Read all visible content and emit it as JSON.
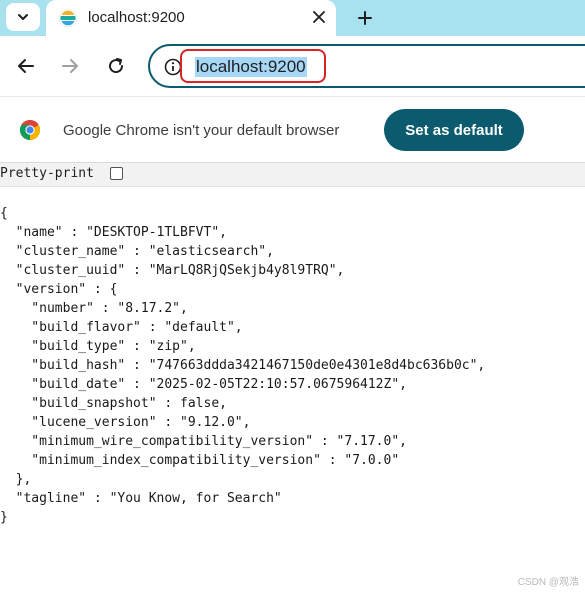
{
  "tab": {
    "title": "localhost:9200"
  },
  "address_bar": {
    "url": "localhost:9200"
  },
  "infobar": {
    "message": "Google Chrome isn't your default browser",
    "button_label": "Set as default"
  },
  "pretty_print": {
    "label": "Pretty-print",
    "checked": false
  },
  "json_lines": [
    "{",
    "  \"name\" : \"DESKTOP-1TLBFVT\",",
    "  \"cluster_name\" : \"elasticsearch\",",
    "  \"cluster_uuid\" : \"MarLQ8RjQSekjb4y8l9TRQ\",",
    "  \"version\" : {",
    "    \"number\" : \"8.17.2\",",
    "    \"build_flavor\" : \"default\",",
    "    \"build_type\" : \"zip\",",
    "    \"build_hash\" : \"747663ddda3421467150de0e4301e8d4bc636b0c\",",
    "    \"build_date\" : \"2025-02-05T22:10:57.067596412Z\",",
    "    \"build_snapshot\" : false,",
    "    \"lucene_version\" : \"9.12.0\",",
    "    \"minimum_wire_compatibility_version\" : \"7.17.0\",",
    "    \"minimum_index_compatibility_version\" : \"7.0.0\"",
    "  },",
    "  \"tagline\" : \"You Know, for Search\"",
    "}"
  ],
  "watermark": "CSDN @观浩",
  "colors": {
    "accent": "#0b5a6e",
    "tabstrip": "#a8e2ef",
    "highlight_box": "#d82424",
    "selection": "#a6d7f7"
  },
  "icons": [
    "tab-search-icon",
    "elastic-favicon",
    "close-icon",
    "plus-icon",
    "back-arrow-icon",
    "forward-arrow-icon",
    "reload-icon",
    "info-icon",
    "chrome-logo-icon"
  ]
}
